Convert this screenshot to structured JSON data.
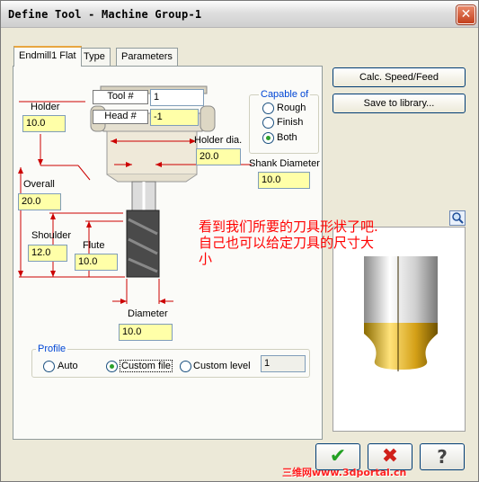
{
  "window": {
    "title": "Define Tool - Machine Group-1",
    "close_glyph": "✕"
  },
  "tabs": [
    {
      "label": "Endmill1 Flat",
      "active": true
    },
    {
      "label": "Type",
      "active": false
    },
    {
      "label": "Parameters",
      "active": false
    }
  ],
  "tool_header": {
    "tool_label": "Tool #",
    "tool_value": "1",
    "head_label": "Head #",
    "head_value": "-1"
  },
  "dimensions": {
    "holder": {
      "label": "Holder",
      "value": "10.0"
    },
    "holder_dia": {
      "label": "Holder dia.",
      "value": "20.0"
    },
    "shank_diameter": {
      "label": "Shank Diameter",
      "value": "10.0"
    },
    "overall": {
      "label": "Overall",
      "value": "20.0"
    },
    "shoulder": {
      "label": "Shoulder",
      "value": "12.0"
    },
    "flute": {
      "label": "Flute",
      "value": "10.0"
    },
    "diameter": {
      "label": "Diameter",
      "value": "10.0"
    }
  },
  "capable_of": {
    "title": "Capable of",
    "options": [
      "Rough",
      "Finish",
      "Both"
    ],
    "selected": "Both"
  },
  "profile": {
    "title": "Profile",
    "options": [
      "Auto",
      "Custom file",
      "Custom level"
    ],
    "selected": "Custom file",
    "level_value": "1"
  },
  "buttons": {
    "calc": "Calc. Speed/Feed",
    "library": "Save to library..."
  },
  "annotation": "看到我们所要的刀具形状了吧.自己也可以给定刀具的尺寸大小",
  "watermark": "三维网www.3dportal.cn",
  "footer": {
    "ok_glyph": "✔",
    "cancel_glyph": "✖",
    "help_glyph": "?"
  },
  "colors": {
    "field_bg": "#ffffa8",
    "tool_body": "#4a4a4a",
    "tool_tip_gold": "#d4a017",
    "annotation_red": "#ff0000"
  },
  "icons": [
    "zoom-icon",
    "ok-check-icon",
    "cancel-x-icon",
    "help-icon"
  ]
}
